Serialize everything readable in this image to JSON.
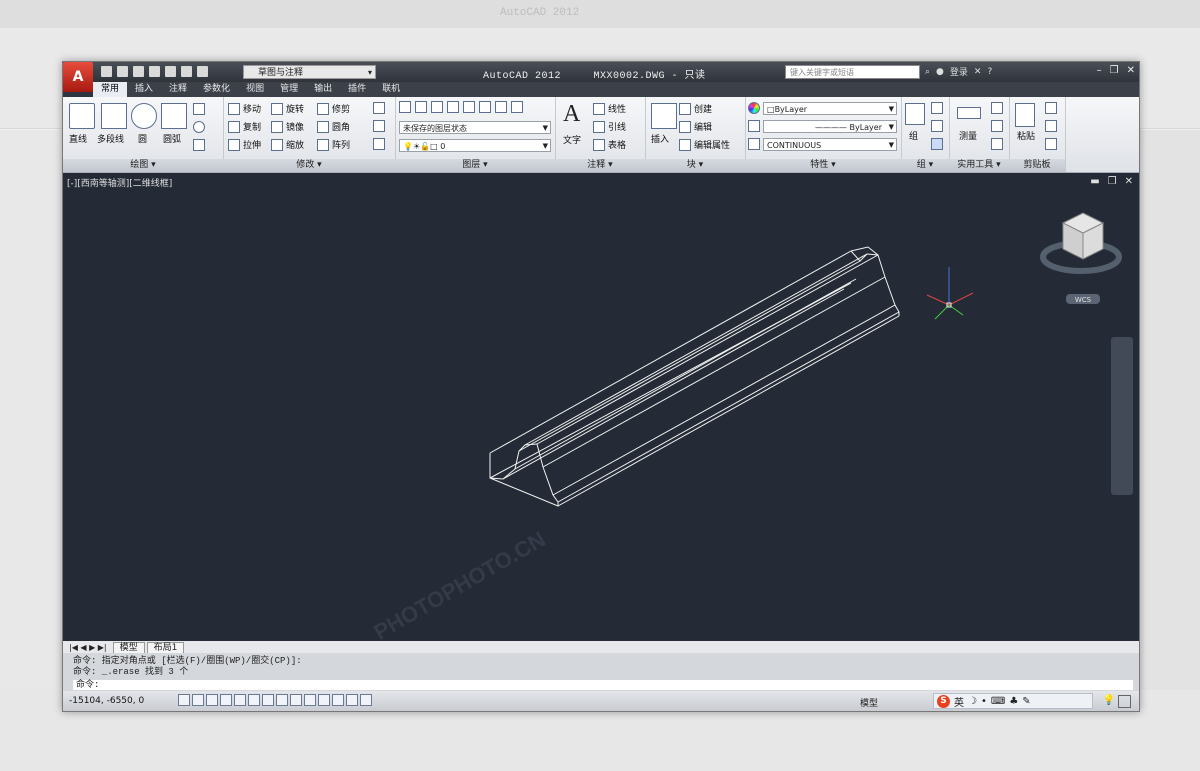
{
  "app": {
    "title": "AutoCAD 2012",
    "filename": "MXX0002.DWG - 只读",
    "workspace": "草图与注释",
    "search_placeholder": "键入关键字或短语",
    "login": "登录"
  },
  "ribbon_tabs": [
    "常用",
    "插入",
    "注释",
    "参数化",
    "视图",
    "管理",
    "输出",
    "插件",
    "联机"
  ],
  "panels": {
    "draw": {
      "label": "绘图",
      "items": [
        "直线",
        "多段线",
        "圆",
        "圆弧"
      ]
    },
    "modify": {
      "label": "修改",
      "items": [
        "移动",
        "旋转",
        "修剪",
        "复制",
        "镜像",
        "圆角",
        "拉伸",
        "缩放",
        "阵列"
      ]
    },
    "layer": {
      "label": "图层",
      "state": "未保存的图层状态",
      "current": "0"
    },
    "annotation": {
      "label": "注释",
      "text": "文字",
      "items": [
        "线性",
        "引线",
        "表格"
      ]
    },
    "block": {
      "label": "块",
      "insert": "插入",
      "items": [
        "创建",
        "编辑",
        "编辑属性"
      ]
    },
    "properties": {
      "label": "特性",
      "color": "ByLayer",
      "lineweight": "ByLayer",
      "linetype": "CONTINUOUS"
    },
    "group": {
      "label": "组",
      "item": "组"
    },
    "utilities": {
      "label": "实用工具",
      "item": "测量"
    },
    "clipboard": {
      "label": "剪贴板",
      "item": "粘贴"
    }
  },
  "viewport": {
    "label": "[-][西南等轴测][二维线框]",
    "wcs": "WCS"
  },
  "layout_tabs": [
    "模型",
    "布局1"
  ],
  "command": {
    "line1": "命令: 指定对角点或 [栏选(F)/圈围(WP)/圈交(CP)]:",
    "line2": "命令: _.erase 找到 3 个",
    "prompt": "命令:"
  },
  "status": {
    "coords": "-15104, -6550, 0",
    "model": "模型",
    "ime_lang": "英"
  },
  "watermark": {
    "text": "PHOTOPHOTO.CN"
  }
}
